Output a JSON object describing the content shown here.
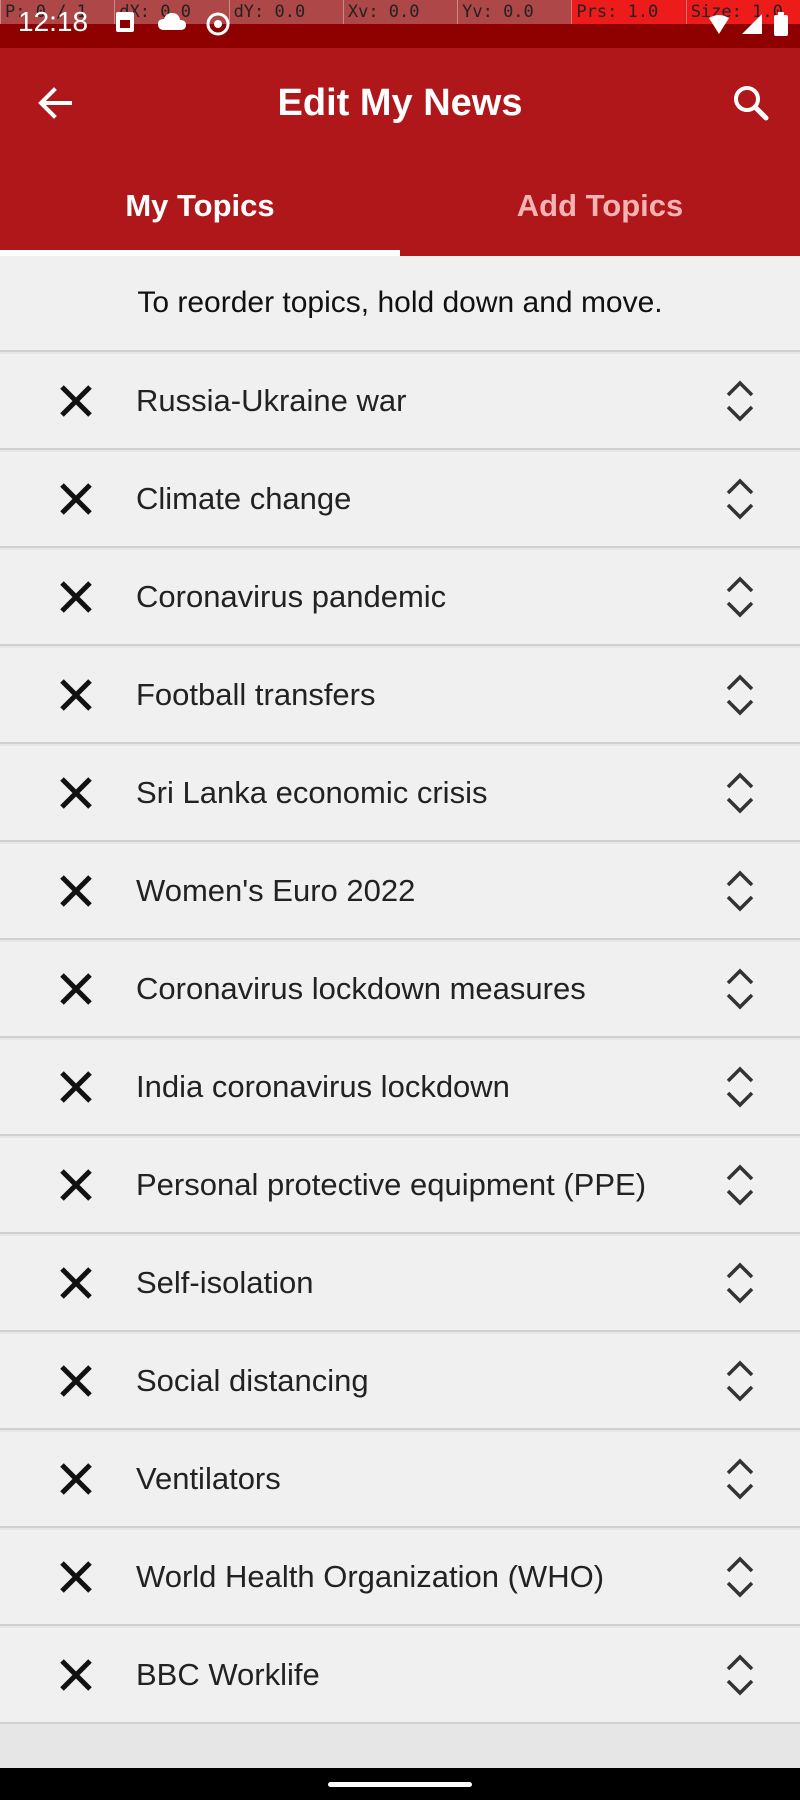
{
  "status_bar": {
    "time": "12:18",
    "debug": [
      "P: 0 / 1",
      "dX: 0.0",
      "dY: 0.0",
      "Xv: 0.0",
      "Yv: 0.0",
      "Prs: 1.0",
      "Size: 1.0"
    ]
  },
  "header": {
    "title": "Edit My News"
  },
  "tabs": [
    {
      "label": "My Topics",
      "active": true
    },
    {
      "label": "Add Topics",
      "active": false
    }
  ],
  "hint": "To reorder topics, hold down and move.",
  "topics": [
    {
      "label": "Russia-Ukraine war"
    },
    {
      "label": "Climate change"
    },
    {
      "label": "Coronavirus pandemic"
    },
    {
      "label": "Football transfers"
    },
    {
      "label": "Sri Lanka economic crisis"
    },
    {
      "label": "Women's Euro 2022"
    },
    {
      "label": "Coronavirus lockdown measures"
    },
    {
      "label": "India coronavirus lockdown"
    },
    {
      "label": "Personal protective equipment (PPE)"
    },
    {
      "label": "Self-isolation"
    },
    {
      "label": "Social distancing"
    },
    {
      "label": "Ventilators"
    },
    {
      "label": "World Health Organization (WHO)"
    },
    {
      "label": "BBC Worklife"
    }
  ],
  "colors": {
    "app_bar": "#b0171a",
    "status_bar": "#8f0000",
    "row_background": "#f0f0f0"
  },
  "icons": {
    "back": "arrow-left-icon",
    "search": "search-icon",
    "remove": "close-icon",
    "reorder": "reorder-icon"
  }
}
